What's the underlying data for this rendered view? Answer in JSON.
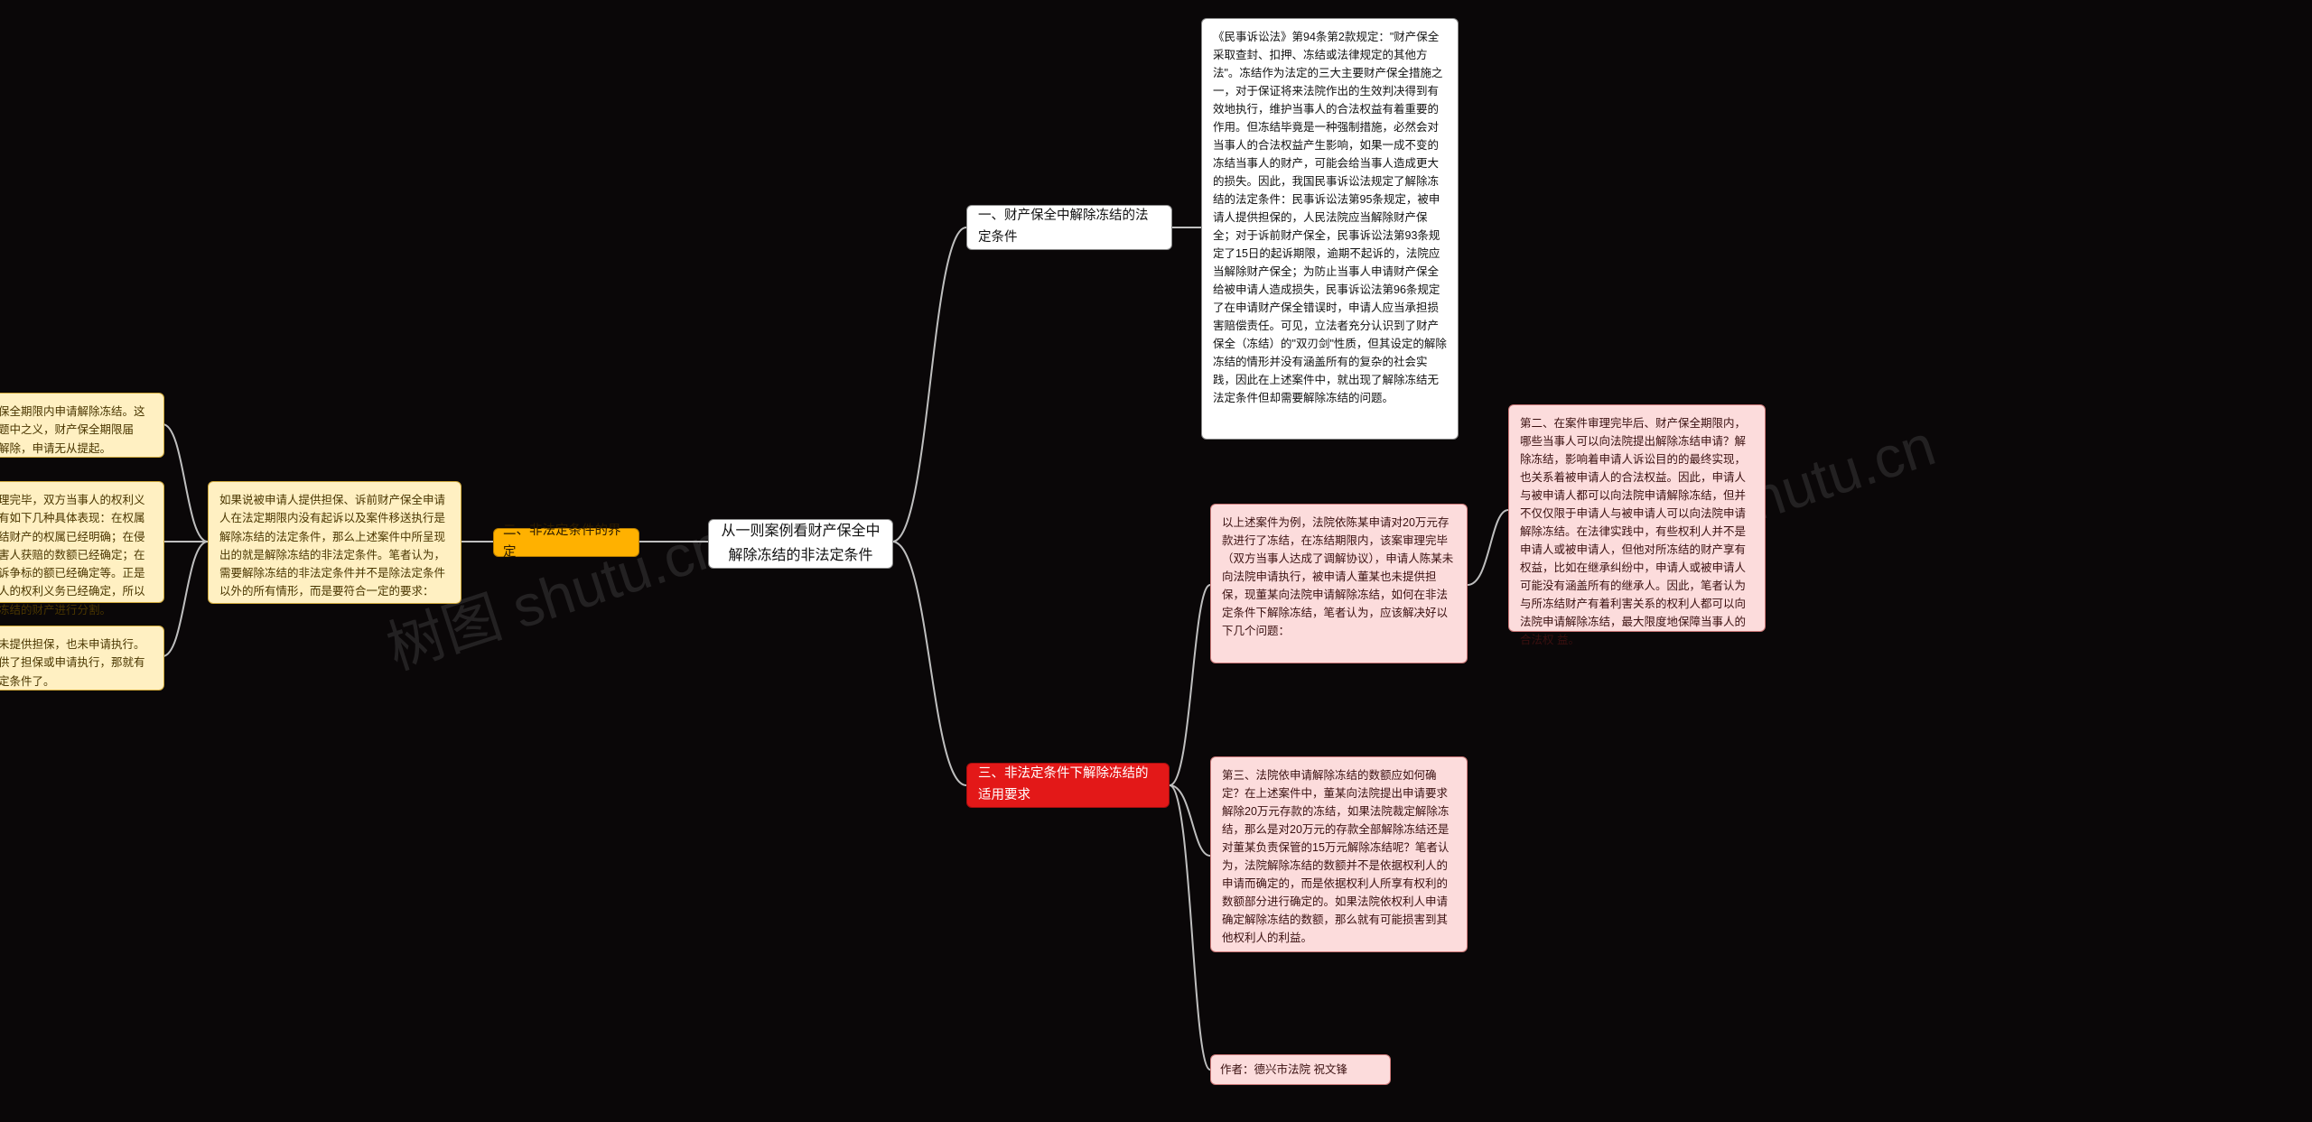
{
  "watermark": "树图 shutu.cn",
  "center": "从一则案例看财产保全中解除冻结的非法定条件",
  "right": {
    "branch1_title": "一、财产保全中解除冻结的法定条件",
    "branch1_text": "《民事诉讼法》第94条第2款规定：\"财产保全采取查封、扣押、冻结或法律规定的其他方法\"。冻结作为法定的三大主要财产保全措施之一，对于保证将来法院作出的生效判决得到有效地执行，维护当事人的合法权益有着重要的作用。但冻结毕竟是一种强制措施，必然会对当事人的合法权益产生影响，如果一成不变的冻结当事人的财产，可能会给当事人造成更大的损失。因此，我国民事诉讼法规定了解除冻结的法定条件：民事诉讼法第95条规定，被申请人提供担保的，人民法院应当解除财产保全；对于诉前财产保全，民事诉讼法第93条规定了15日的起诉期限，逾期不起诉的，法院应当解除财产保全；为防止当事人申请财产保全给被申请人造成损失，民事诉讼法第96条规定了在申请财产保全错误时，申请人应当承担损害赔偿责任。可见，立法者充分认识到了财产保全（冻结）的\"双刃剑\"性质，但其设定的解除冻结的情形并没有涵盖所有的复杂的社会实践，因此在上述案件中，就出现了解除冻结无法定条件但却需要解除冻结的问题。",
    "branch3_title": "三、非法定条件下解除冻结的适用要求",
    "branch3_a": "以上述案件为例，法院依陈某申请对20万元存款进行了冻结，在冻结期限内，该案审理完毕（双方当事人达成了调解协议），申请人陈某未向法院申请执行，被申请人董某也未提供担保，现董某向法院申请解除冻结，如何在非法定条件下解除冻结，笔者认为，应该解决好以下几个问题：",
    "branch3_b": "第二、在案件审理完毕后、财产保全期限内，哪些当事人可以向法院提出解除冻结申请？解除冻结，影响着申请人诉讼目的的最终实现，也关系着被申请人的合法权益。因此，申请人与被申请人都可以向法院申请解除冻结，但并不仅仅限于申请人与被申请人可以向法院申请解除冻结。在法律实践中，有些权利人并不是申请人或被申请人，但他对所冻结的财产享有权益，比如在继承纠纷中，申请人或被申请人可能没有涵盖所有的继承人。因此，笔者认为与所冻结财产有着利害关系的权利人都可以向法院申请解除冻结，最大限度地保障当事人的合法权 益。",
    "branch3_c": "第三、法院依申请解除冻结的数额应如何确定？在上述案件中，董某向法院提出申请要求解除20万元存款的冻结，如果法院裁定解除冻结，那么是对20万元的存款全部解除冻结还是对董某负责保管的15万元解除冻结呢？笔者认为，法院解除冻结的数额并不是依据权利人的申请而确定的，而是依据权利人所享有权利的数额部分进行确定的。如果法院依权利人申请确定解除冻结的数额，那么就有可能损害到其他权利人的利益。",
    "branch3_d": "作者：德兴市法院 祝文锋"
  },
  "left": {
    "branch2_title": "二、非法定条件的界定",
    "branch2_text": "如果说被申请人提供担保、诉前财产保全申请人在法定期限内没有起诉以及案件移送执行是解除冻结的法定条件，那么上述案件中所呈现出的就是解除冻结的非法定条件。笔者认为，需要解除冻结的非法定条件并不是除法定条件以外的所有情形，而是要符合一定的要求：",
    "branch2_sub1": "（一）在财产保全期限内申请解除冻结。这是解除冻结的题中之义，财产保全期限届满，冻结自动解除，申请无从提起。",
    "branch2_sub2": "（二）案件审理完毕，双方当事人的权利义务已经确定。有如下几种具体表现：在权属纠纷中，所冻结财产的权属已经明确；在侵权纠纷中，受害人获赔的数额已经确定；在合同纠纷中，诉争标的额已经确定等。正是因为双方当事人的权利义务已经确定，所以才有可能对所冻结的财产进行分割。",
    "branch2_sub3": "（三）当事人未提供担保，也未申请执行。如果当事人提供了担保或申请执行，那就有解除冻结的法定条件了。"
  }
}
